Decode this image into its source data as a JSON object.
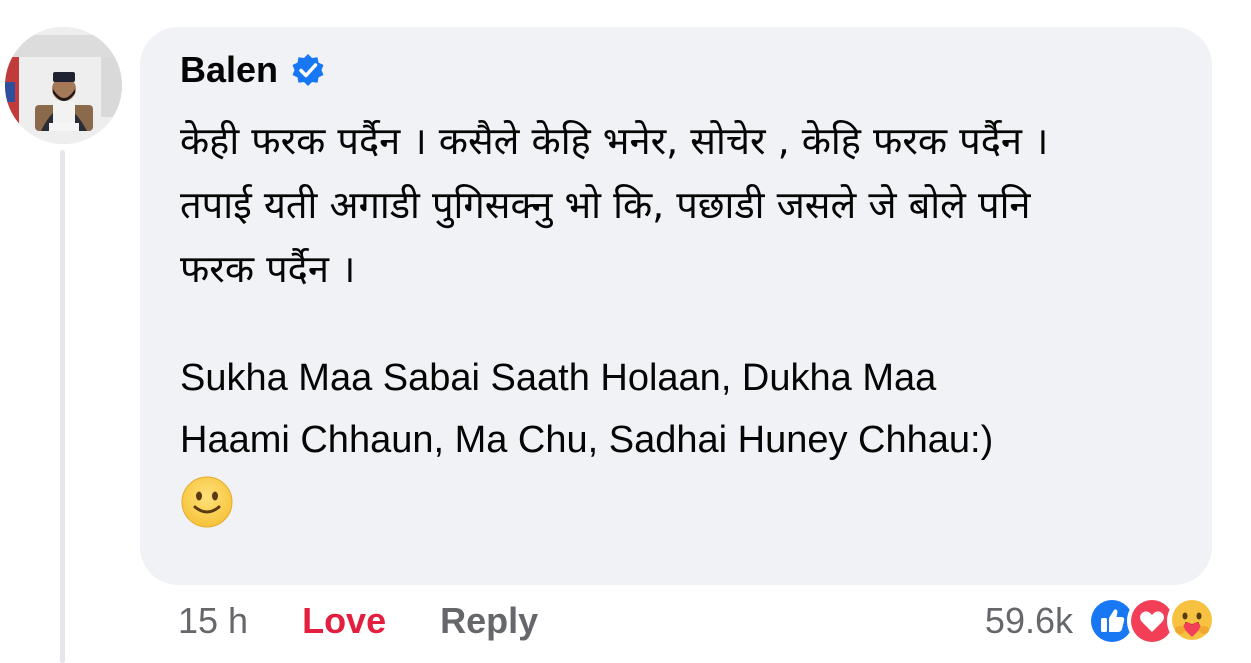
{
  "comment": {
    "author": "Balen",
    "verified_icon": "verified-badge-icon",
    "text_lines": [
      "केही फरक पर्दैन । कसैले केहि भनेर, सोचेर , केहि फरक पर्दैन ।",
      "तपाई यती अगाडी पुगिसक्नु भो कि, पछाडी जसले जे बोले पनि",
      "फरक पर्दैन ।"
    ],
    "english_lines": [
      "Sukha Maa Sabai Saath Holaan, Dukha Maa",
      "Haami Chhaun, Ma Chu, Sadhai Huney Chhau:)"
    ],
    "emoji": "slightly-smiling-face-icon"
  },
  "actions": {
    "time": "15 h",
    "love_label": "Love",
    "reply_label": "Reply"
  },
  "reactions": {
    "count": "59.6k",
    "icons": [
      "like-reaction-icon",
      "love-reaction-icon",
      "care-reaction-icon"
    ]
  },
  "colors": {
    "bubble": "#f0f2f5",
    "verified": "#1877f2",
    "love": "#e41e3f",
    "muted": "#65676b"
  }
}
